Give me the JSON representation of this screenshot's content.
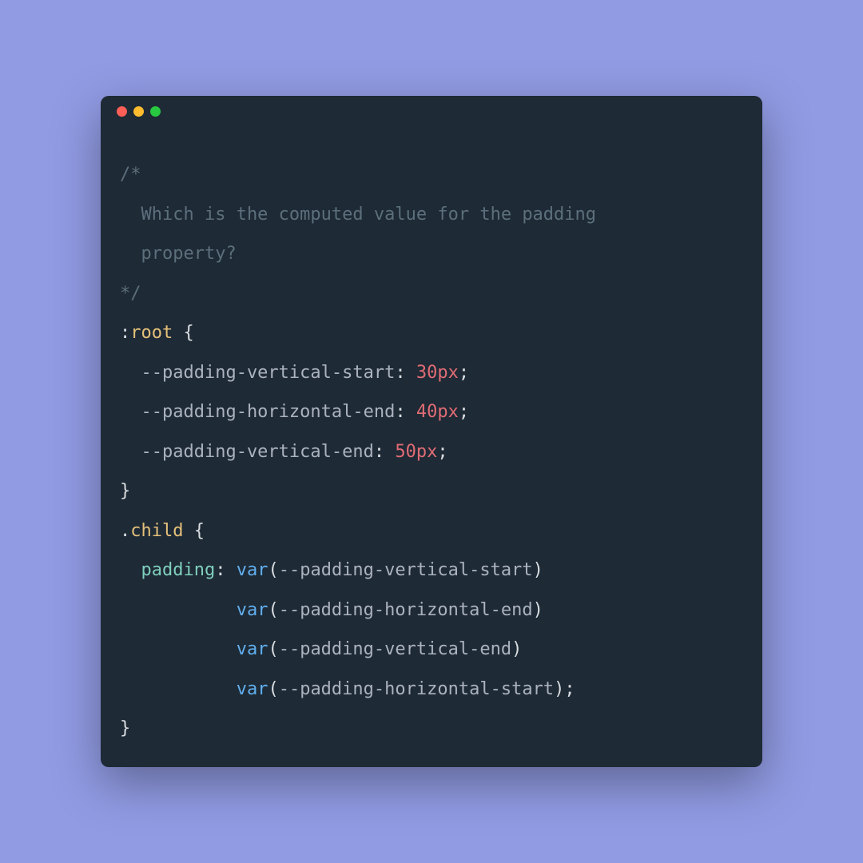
{
  "colors": {
    "background": "#919be3",
    "window": "#1e2a35",
    "close": "#ff5f57",
    "minimize": "#febc2e",
    "maximize": "#28c840",
    "comment": "#5c6f7c",
    "selector_name": "#e5c07b",
    "punctuation": "#d9dde1",
    "property": "#7fcfbd",
    "variable": "#abb2bf",
    "number": "#e06c75",
    "function": "#61afef"
  },
  "code": {
    "comment_open": "/*",
    "comment_line1": "  Which is the computed value for the padding",
    "comment_line2": "  property?",
    "comment_close": "*/",
    "pseudo": ":",
    "root": "root",
    "brace_open": " {",
    "brace_close": "}",
    "var1_name": "  --padding-vertical-start",
    "var1_val": "30px",
    "var2_name": "  --padding-horizontal-end",
    "var2_val": "40px",
    "var3_name": "  --padding-vertical-end",
    "var3_val": "50px",
    "colon_space": ": ",
    "semi": ";",
    "dot": ".",
    "child": "child",
    "padding_prop": "  padding",
    "varfn": "var",
    "paren_open": "(",
    "paren_close": ")",
    "arg1": "--padding-vertical-start",
    "arg2": "--padding-horizontal-end",
    "arg3": "--padding-vertical-end",
    "arg4": "--padding-horizontal-start",
    "indent_cont": "           "
  }
}
